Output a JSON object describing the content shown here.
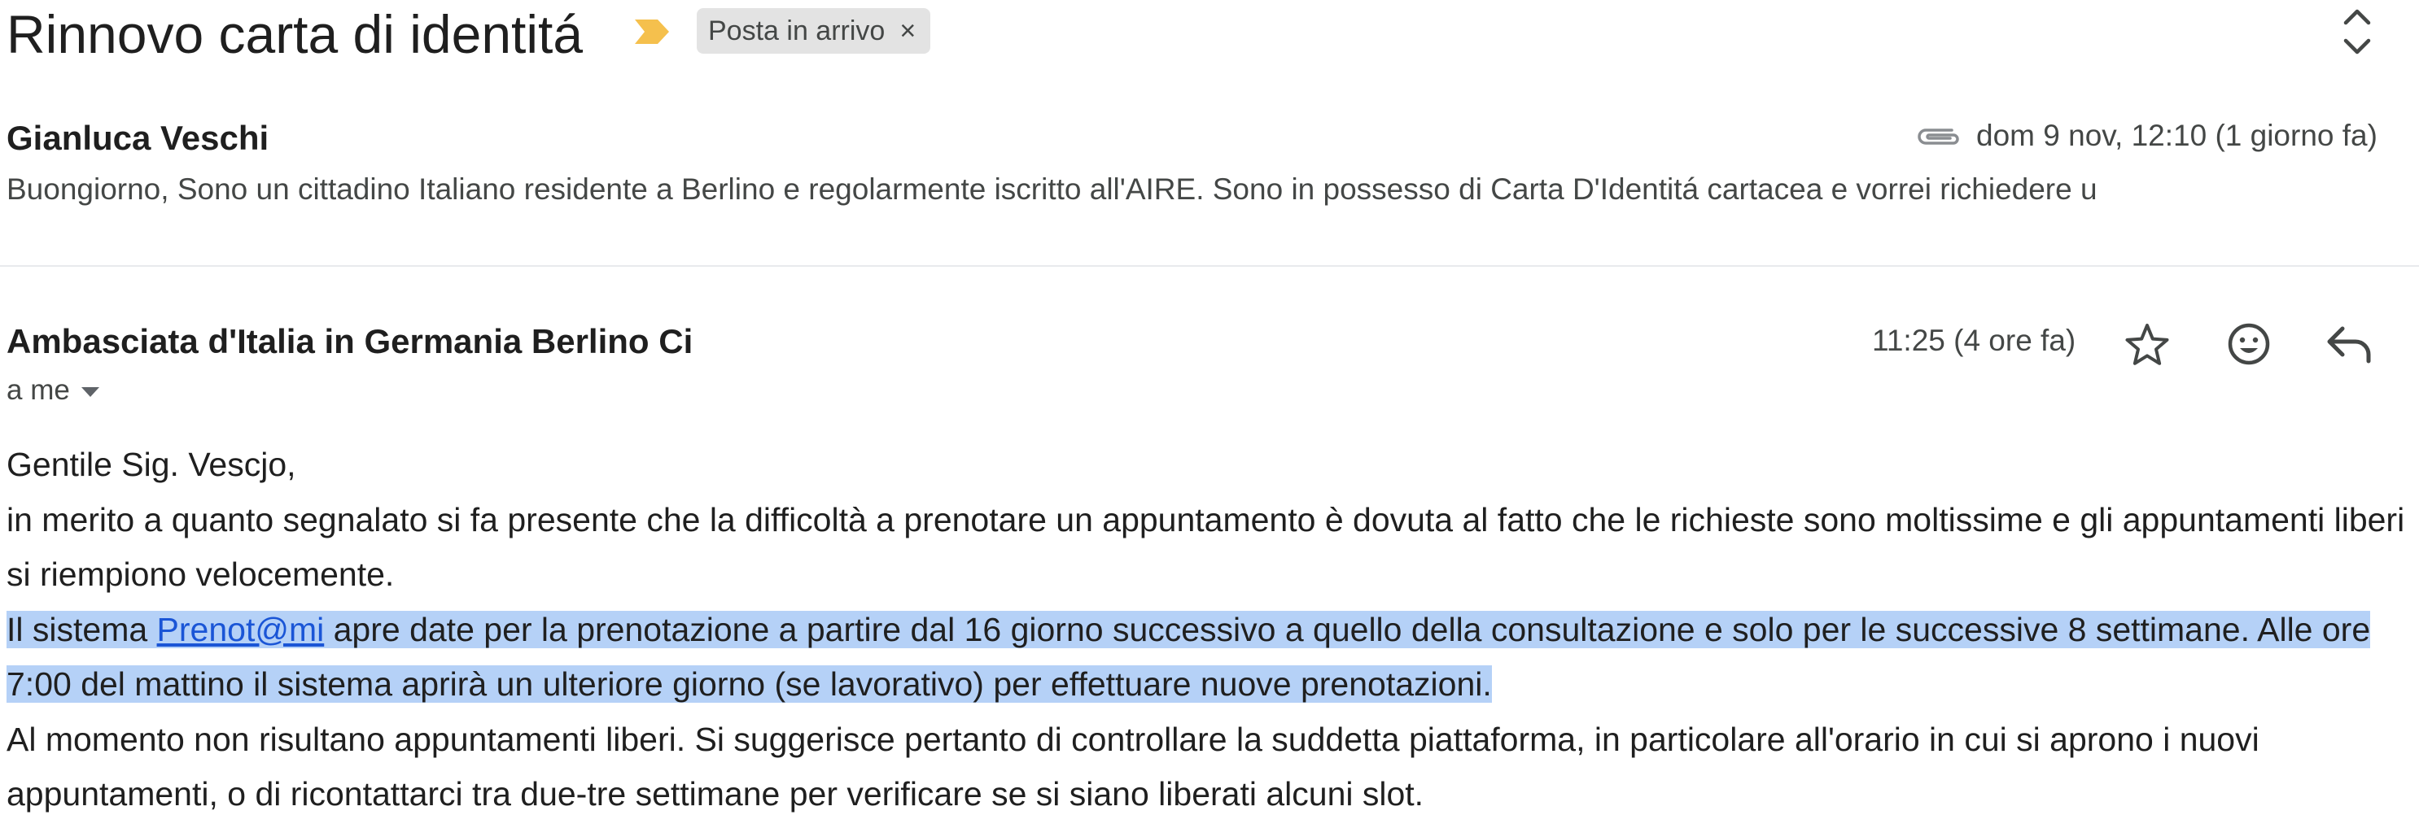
{
  "thread": {
    "subject": "Rinnovo carta di identitá",
    "label_chip": "Posta in arrivo",
    "chip_close": "×"
  },
  "message1": {
    "sender": "Gianluca Veschi",
    "date": "dom 9 nov, 12:10 (1 giorno fa)",
    "snippet": "Buongiorno, Sono un cittadino Italiano residente a Berlino e regolarmente iscritto all'AIRE. Sono in possesso di Carta D'Identitá cartacea e vorrei richiedere u"
  },
  "message2": {
    "sender": "Ambasciata d'Italia in Germania Berlino Ci",
    "time": "11:25 (4 ore fa)",
    "recipients": "a me",
    "body": {
      "greeting": "Gentile Sig. Vescjo,",
      "para1": "in merito a quanto segnalato si fa presente che la difficoltà a prenotare un appuntamento è dovuta al fatto che le richieste sono moltissime e gli appuntamenti liberi si riempiono velocemente.",
      "para2_before": "Il sistema ",
      "para2_link": "Prenot@mi",
      "para2_after": " apre date per la prenotazione a partire dal 16 giorno successivo a quello della consultazione e solo per le successive 8 settimane. Alle ore 7:00 del mattino il sistema aprirà un ulteriore giorno (se lavorativo) per effettuare nuove prenotazioni.",
      "para3": "Al momento non risultano appuntamenti liberi. Si suggerisce pertanto di controllare la suddetta piattaforma, in particolare all'orario in cui si aprono i nuovi appuntamenti, o di ricontattarci tra due-tre settimane per verificare se si siano liberati alcuni slot."
    }
  },
  "icons": {
    "label_marker": "importance-marker-icon",
    "expand_toggle": "unfold-icon",
    "attachment": "attachment-icon",
    "star": "star-icon",
    "emoji": "emoji-icon",
    "reply": "reply-icon",
    "caret": "caret-down-icon"
  },
  "colors": {
    "importance_marker": "#f5c04d",
    "chip_background": "#e3e3e3",
    "selection_highlight": "#b5d1f7",
    "link": "#1a55d6",
    "secondary_text": "#444746"
  }
}
